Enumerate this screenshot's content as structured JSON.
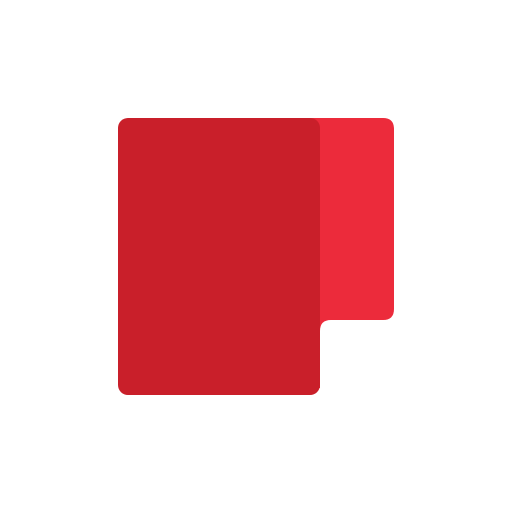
{
  "icon": {
    "name": "red-document-tab-icon",
    "colors": {
      "front": "#c91f2a",
      "back": "#ec2b3b",
      "background": "#ffffff"
    }
  }
}
